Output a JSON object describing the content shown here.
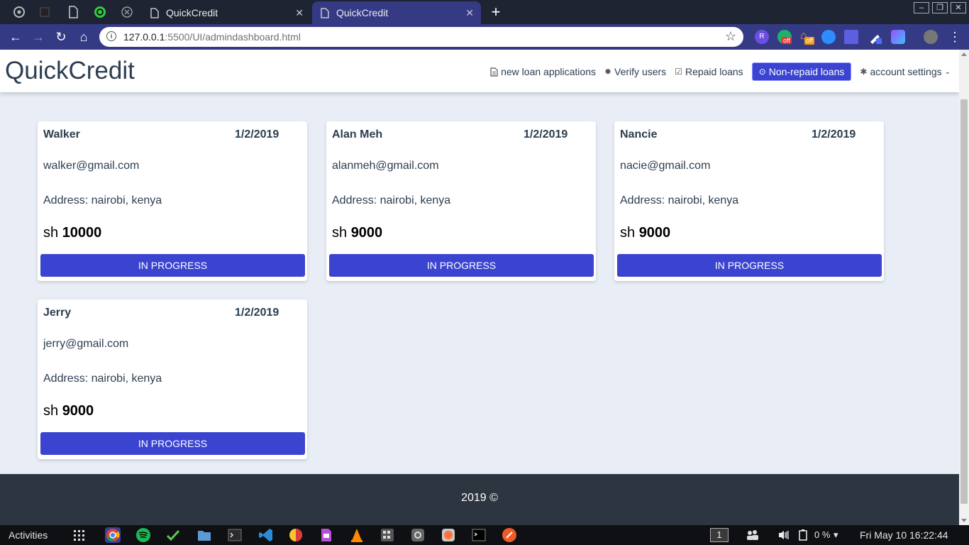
{
  "browser": {
    "tabs": [
      {
        "title": "QuickCredit",
        "active": false
      },
      {
        "title": "QuickCredit",
        "active": true
      }
    ],
    "url_host": "127.0.0.1",
    "url_rest": ":5500/UI/admindashboard.html",
    "extension_badges": {
      "off1": "off",
      "off2": "off",
      "r": "R"
    }
  },
  "header": {
    "brand": "QuickCredit",
    "nav": [
      {
        "label": "new loan applications",
        "icon": "file-icon"
      },
      {
        "label": "Verify users",
        "icon": "gear-icon"
      },
      {
        "label": "Repaid loans",
        "icon": "check-square-icon"
      },
      {
        "label": "Non-repaid loans",
        "icon": "clock-icon",
        "active": true
      },
      {
        "label": "account settings",
        "icon": "cog-icon"
      }
    ]
  },
  "loans": [
    {
      "name": "Walker",
      "date": "1/2/2019",
      "email": "walker@gmail.com",
      "address": "Address: nairobi, kenya",
      "currency": "sh",
      "amount": "10000",
      "status": "IN PROGRESS"
    },
    {
      "name": "Alan Meh",
      "date": "1/2/2019",
      "email": "alanmeh@gmail.com",
      "address": "Address: nairobi, kenya",
      "currency": "sh",
      "amount": "9000",
      "status": "IN PROGRESS"
    },
    {
      "name": "Nancie",
      "date": "1/2/2019",
      "email": "nacie@gmail.com",
      "address": "Address: nairobi, kenya",
      "currency": "sh",
      "amount": "9000",
      "status": "IN PROGRESS"
    },
    {
      "name": "Jerry",
      "date": "1/2/2019",
      "email": "jerry@gmail.com",
      "address": "Address: nairobi, kenya",
      "currency": "sh",
      "amount": "9000",
      "status": "IN PROGRESS"
    }
  ],
  "footer": {
    "text": "2019 ©"
  },
  "panel": {
    "activities": "Activities",
    "workspace": "1",
    "battery": "0 %",
    "clock": "Fri May 10  16:22:44"
  },
  "colors": {
    "accent": "#3b44d0",
    "chrome": "#353a85",
    "footer": "#2d3540",
    "page_bg": "#e9edf5"
  }
}
